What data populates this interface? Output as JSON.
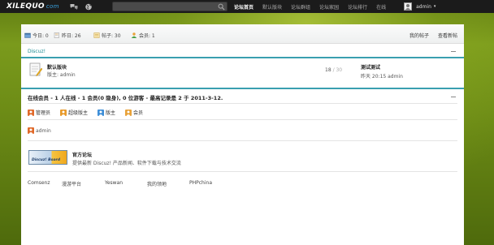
{
  "topbar": {
    "logo_main": "XILEQUO",
    "logo_suffix": "com",
    "search_placeholder": "",
    "nav": [
      {
        "label": "论坛首页",
        "active": true
      },
      {
        "label": "默认版块",
        "active": false
      },
      {
        "label": "论坛群组",
        "active": false
      },
      {
        "label": "论坛家园",
        "active": false
      },
      {
        "label": "论坛排行",
        "active": false
      },
      {
        "label": "在线",
        "active": false
      }
    ],
    "user": "admin",
    "caret": "▾"
  },
  "stats": {
    "today": "今日: 0",
    "yesterday": "昨日: 26",
    "posts": "帖子: 30",
    "members": "会员: 1",
    "my_posts": "我的帖子",
    "view_new": "查看新帖"
  },
  "category": {
    "title": "Discuz!",
    "forum": {
      "name": "默认版块",
      "moderator": "版主: admin",
      "count": "18",
      "total": "/ 30",
      "last_title": "测试测试",
      "last_time": "昨天 20:15 admin"
    }
  },
  "online": {
    "summary": "在线会员 - 1 人在线 - 1 会员(0 隐身), 0 位游客 - 最高记录是 2 于 2011-3-12.",
    "legend": [
      "管理员",
      "超级版主",
      "版主",
      "会员"
    ],
    "legend_colors": [
      "#e06a2b",
      "#e89a2b",
      "#3f8fd8",
      "#e8a23a"
    ],
    "users": [
      "admin"
    ]
  },
  "links": {
    "logo_text": "Discuz! Board",
    "title": "官方论坛",
    "desc": "提供最新 Discuz! 产品新闻、软件下载与技术交流",
    "text_links": [
      "Comsenz",
      "漫游平台",
      "Yeswan",
      "我的领地",
      "PHPchina"
    ]
  }
}
